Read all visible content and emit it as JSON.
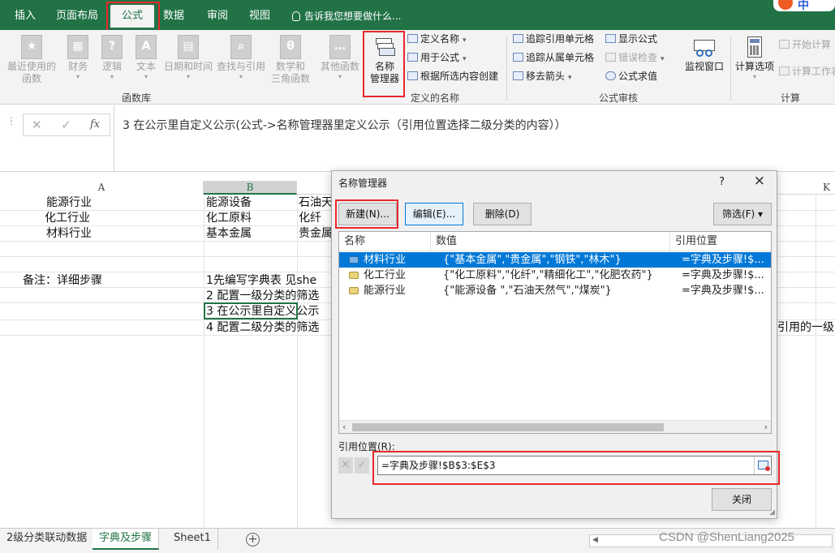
{
  "ribbon_tabs": [
    {
      "label": "插入"
    },
    {
      "label": "页面布局"
    },
    {
      "label": "公式"
    },
    {
      "label": "数据"
    },
    {
      "label": "审阅"
    },
    {
      "label": "视图"
    }
  ],
  "tell_me": "告诉我您想要做什么...",
  "sogou_char": "中",
  "library": {
    "recent": "最近使用的\n函数",
    "finance": "财务",
    "logic": "逻辑",
    "text": "文本",
    "datetime": "日期和时间",
    "lookup": "查找与引用",
    "math": "数学和\n三角函数",
    "other": "其他函数",
    "group_label": "函数库"
  },
  "names": {
    "manager": "名称\n管理器",
    "define": "定义名称",
    "use_in_formula": "用于公式",
    "create_from_sel": "根据所选内容创建",
    "group_label": "定义的名称"
  },
  "audit": {
    "trace_precedents": "追踪引用单元格",
    "trace_dependents": "追踪从属单元格",
    "remove_arrows": "移去箭头",
    "show_formulas": "显示公式",
    "error_check": "错误检查",
    "evaluate": "公式求值",
    "watch": "监视窗口",
    "group_label": "公式审核"
  },
  "calc": {
    "options": "计算选项",
    "calc_now": "开始计算",
    "calc_sheet": "计算工作表",
    "group_label": "计算"
  },
  "formula_bar": {
    "fx": "fx",
    "content": "3 在公示里自定义公示(公式->名称管理器里定义公示（引用位置选择二级分类的内容））"
  },
  "columns": [
    "A",
    "B",
    "K"
  ],
  "cells": {
    "a1": "能源行业",
    "a2": "化工行业",
    "a3": "材料行业",
    "b1": "能源设备",
    "b2": "化工原料",
    "b3": "基本金属",
    "c1": "石油天",
    "c2": "化纤",
    "c3": "贵金属",
    "note_label": "备注：详细步骤",
    "step1": "1先编写字典表  见she",
    "step2": "2 配置一级分类的筛选",
    "step3": "3 在公示里自定义公示",
    "step4": "4 配置二级分类的筛选",
    "overflow": "引用的一级"
  },
  "dialog": {
    "title": "名称管理器",
    "help": "?",
    "close": "×",
    "new_btn": "新建(N)...",
    "edit_btn": "编辑(E)...",
    "delete_btn": "删除(D)",
    "filter_btn": "筛选(F) ▾",
    "headers": {
      "name": "名称",
      "value": "数值",
      "ref": "引用位置"
    },
    "rows": [
      {
        "name": "材料行业",
        "value": "{\"基本金属\",\"贵金属\",\"钢铁\",\"林木\"}",
        "ref": "=字典及步骤!$...",
        "selected": true
      },
      {
        "name": "化工行业",
        "value": "{\"化工原料\",\"化纤\",\"精细化工\",\"化肥农药\"}",
        "ref": "=字典及步骤!$...",
        "selected": false
      },
      {
        "name": "能源行业",
        "value": "{\"能源设备 \",\"石油天然气\",\"煤炭\"}",
        "ref": "=字典及步骤!$...",
        "selected": false
      }
    ],
    "ref_label": "引用位置(R):",
    "ref_value": "=字典及步骤!$B$3:$E$3",
    "close_btn": "关闭"
  },
  "sheets": [
    {
      "label": "2级分类联动数据"
    },
    {
      "label": "字典及步骤"
    },
    {
      "label": "Sheet1"
    }
  ],
  "watermark": "CSDN @ShenLiang2025",
  "colors": {
    "excel_green": "#217346",
    "highlight_red": "#e8282c",
    "selection_blue": "#0078d7"
  }
}
